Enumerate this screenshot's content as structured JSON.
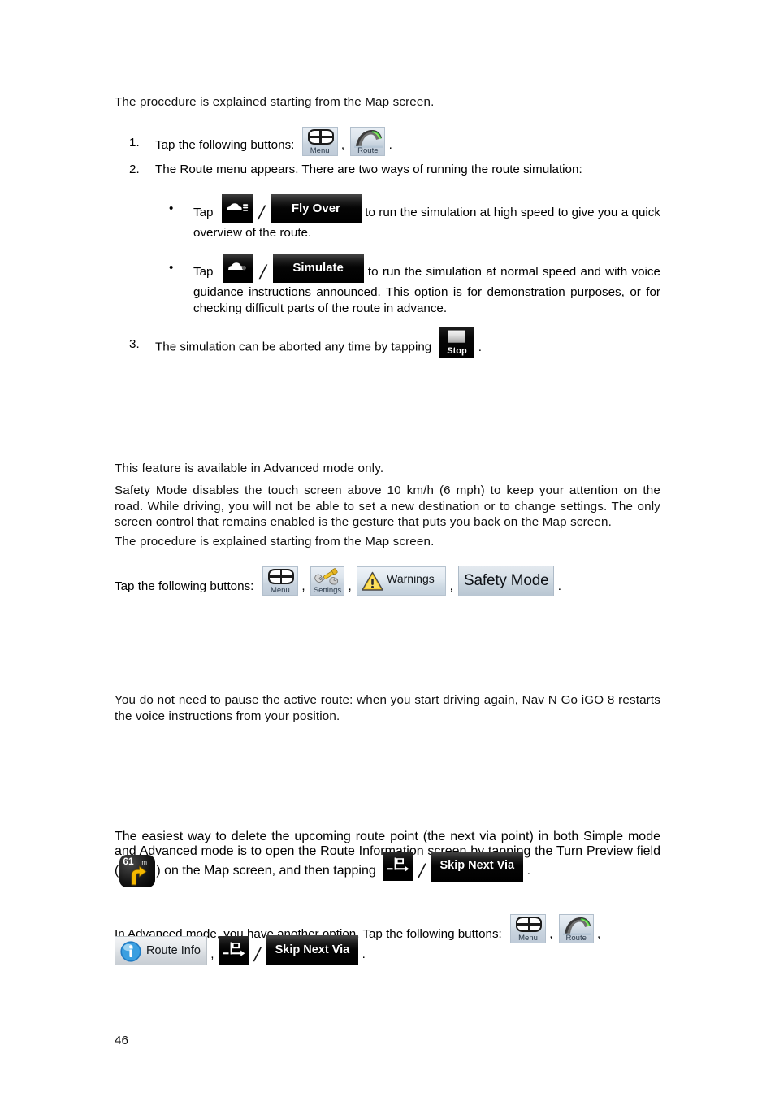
{
  "page": {
    "number": "46"
  },
  "section_simulation": {
    "intro": "The procedure is explained starting from the Map screen.",
    "step1": {
      "num": "1.",
      "text": "Tap the following buttons:",
      "buttons": [
        {
          "name": "menu",
          "label": "Menu"
        },
        {
          "name": "route",
          "label": "Route"
        }
      ],
      "separator": ",",
      "terminator": "."
    },
    "step2": {
      "num": "2.",
      "text": "The Route menu appears. There are two ways of running the route simulation:",
      "bullets": [
        {
          "bullet": "•",
          "lead": "Tap",
          "glyph_icon": "car-speed-icon",
          "slash": "/",
          "button_label": "Fly Over",
          "tail": "to run the simulation at high speed to give you a quick overview of the route."
        },
        {
          "bullet": "•",
          "lead": "Tap",
          "glyph_icon": "car-icon",
          "slash": "/",
          "button_label": "Simulate",
          "tail": "to run the simulation at normal speed and with voice guidance instructions announced. This option is for demonstration purposes, or for checking difficult parts of the route in advance."
        }
      ]
    },
    "step3": {
      "num": "3.",
      "text": "The simulation can be aborted any time by tapping",
      "button_label": "Stop",
      "terminator": "."
    }
  },
  "section_safety": {
    "para1": "This feature is available in Advanced mode only.",
    "para2": "Safety Mode disables the touch screen above 10 km/h (6 mph) to keep your attention on the road. While driving, you will not be able to set a new destination or to change settings. The only screen control that remains enabled is the gesture that puts you back on the Map screen.",
    "para3": "The procedure is explained starting from the Map screen.",
    "tap_lead": "Tap the following buttons:",
    "buttons": [
      {
        "name": "menu",
        "label": "Menu"
      },
      {
        "name": "settings",
        "label": "Settings"
      },
      {
        "name": "warnings",
        "label": "Warnings"
      },
      {
        "name": "safety-mode",
        "label": "Safety Mode"
      }
    ],
    "separator": ",",
    "terminator": "."
  },
  "section_pause": {
    "para1": "You do not need to pause the active route: when you start driving again, Nav N Go iGO 8 restarts the voice instructions from your position."
  },
  "section_skip_via": {
    "para1_a": "The easiest way to delete the upcoming route point (the next via point) in both Simple mode and Advanced mode is to open the Route Information screen by tapping the Turn Preview field (",
    "para1_b": ") on the Map screen, and then tapping",
    "turn_preview": {
      "distance": "61",
      "unit": "m",
      "icon": "turn-right-arrow-icon"
    },
    "slash": "/",
    "skip_button_label": "Skip Next Via",
    "terminator": ".",
    "para2": "In Advanced mode, you have another option. Tap the following buttons:",
    "buttons_row1": [
      {
        "name": "menu",
        "label": "Menu"
      },
      {
        "name": "route",
        "label": "Route"
      }
    ],
    "buttons_row2": [
      {
        "name": "route-info",
        "label": "Route Info"
      }
    ],
    "separator": ","
  }
}
